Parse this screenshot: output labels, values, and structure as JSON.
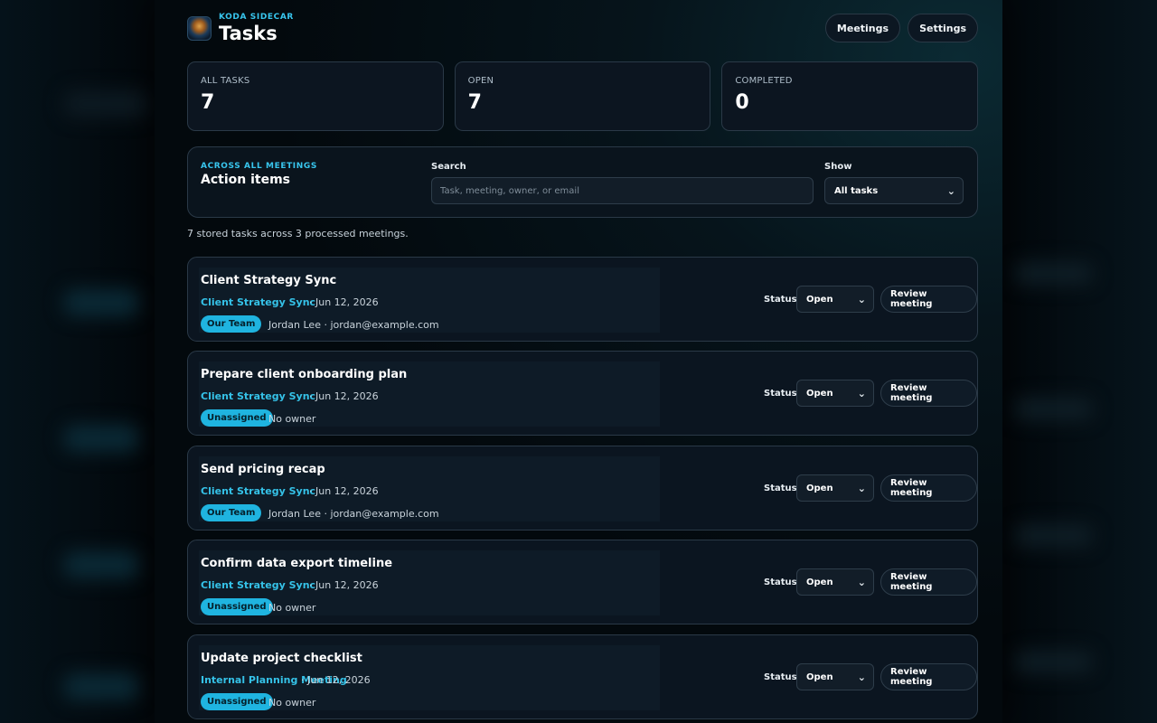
{
  "header": {
    "brand": "KODA SIDECAR",
    "title": "Tasks",
    "buttons": {
      "meetings": "Meetings",
      "settings": "Settings"
    }
  },
  "stats": [
    {
      "label": "ALL TASKS",
      "value": "7"
    },
    {
      "label": "OPEN",
      "value": "7"
    },
    {
      "label": "COMPLETED",
      "value": "0"
    }
  ],
  "filter": {
    "eyebrow": "ACROSS ALL MEETINGS",
    "title": "Action items",
    "search_label": "Search",
    "search_placeholder": "Task, meeting, owner, or email",
    "search_value": "",
    "show_label": "Show",
    "show_value": "All tasks"
  },
  "summary": "7 stored tasks across 3 processed meetings.",
  "status_label": "Status",
  "review_label": "Review meeting",
  "tasks": [
    {
      "title": "Client Strategy Sync",
      "meeting": "Client Strategy Sync",
      "date": "· Jun 12, 2026",
      "badge": "Our Team",
      "owner": "Jordan Lee · jordan@example.com",
      "status": "Open"
    },
    {
      "title": "Prepare client onboarding plan",
      "meeting": "Client Strategy Sync",
      "date": "· Jun 12, 2026",
      "badge": "Unassigned",
      "owner": "No owner",
      "status": "Open"
    },
    {
      "title": "Send pricing recap",
      "meeting": "Client Strategy Sync",
      "date": "· Jun 12, 2026",
      "badge": "Our Team",
      "owner": "Jordan Lee · jordan@example.com",
      "status": "Open"
    },
    {
      "title": "Confirm data export timeline",
      "meeting": "Client Strategy Sync",
      "date": "· Jun 12, 2026",
      "badge": "Unassigned",
      "owner": "No owner",
      "status": "Open"
    },
    {
      "title": "Update project checklist",
      "meeting": "Internal Planning Meeting",
      "date": "· Jun 12, 2026",
      "badge": "Unassigned",
      "owner": "No owner",
      "status": "Open"
    }
  ],
  "colors": {
    "accent": "#38c6ee",
    "badge": "#1fb4e0",
    "background": "#03090d",
    "card": "#0b1520"
  },
  "icons": {
    "logo": "koda-logo-icon",
    "select_caret": "chevron-down-icon"
  }
}
